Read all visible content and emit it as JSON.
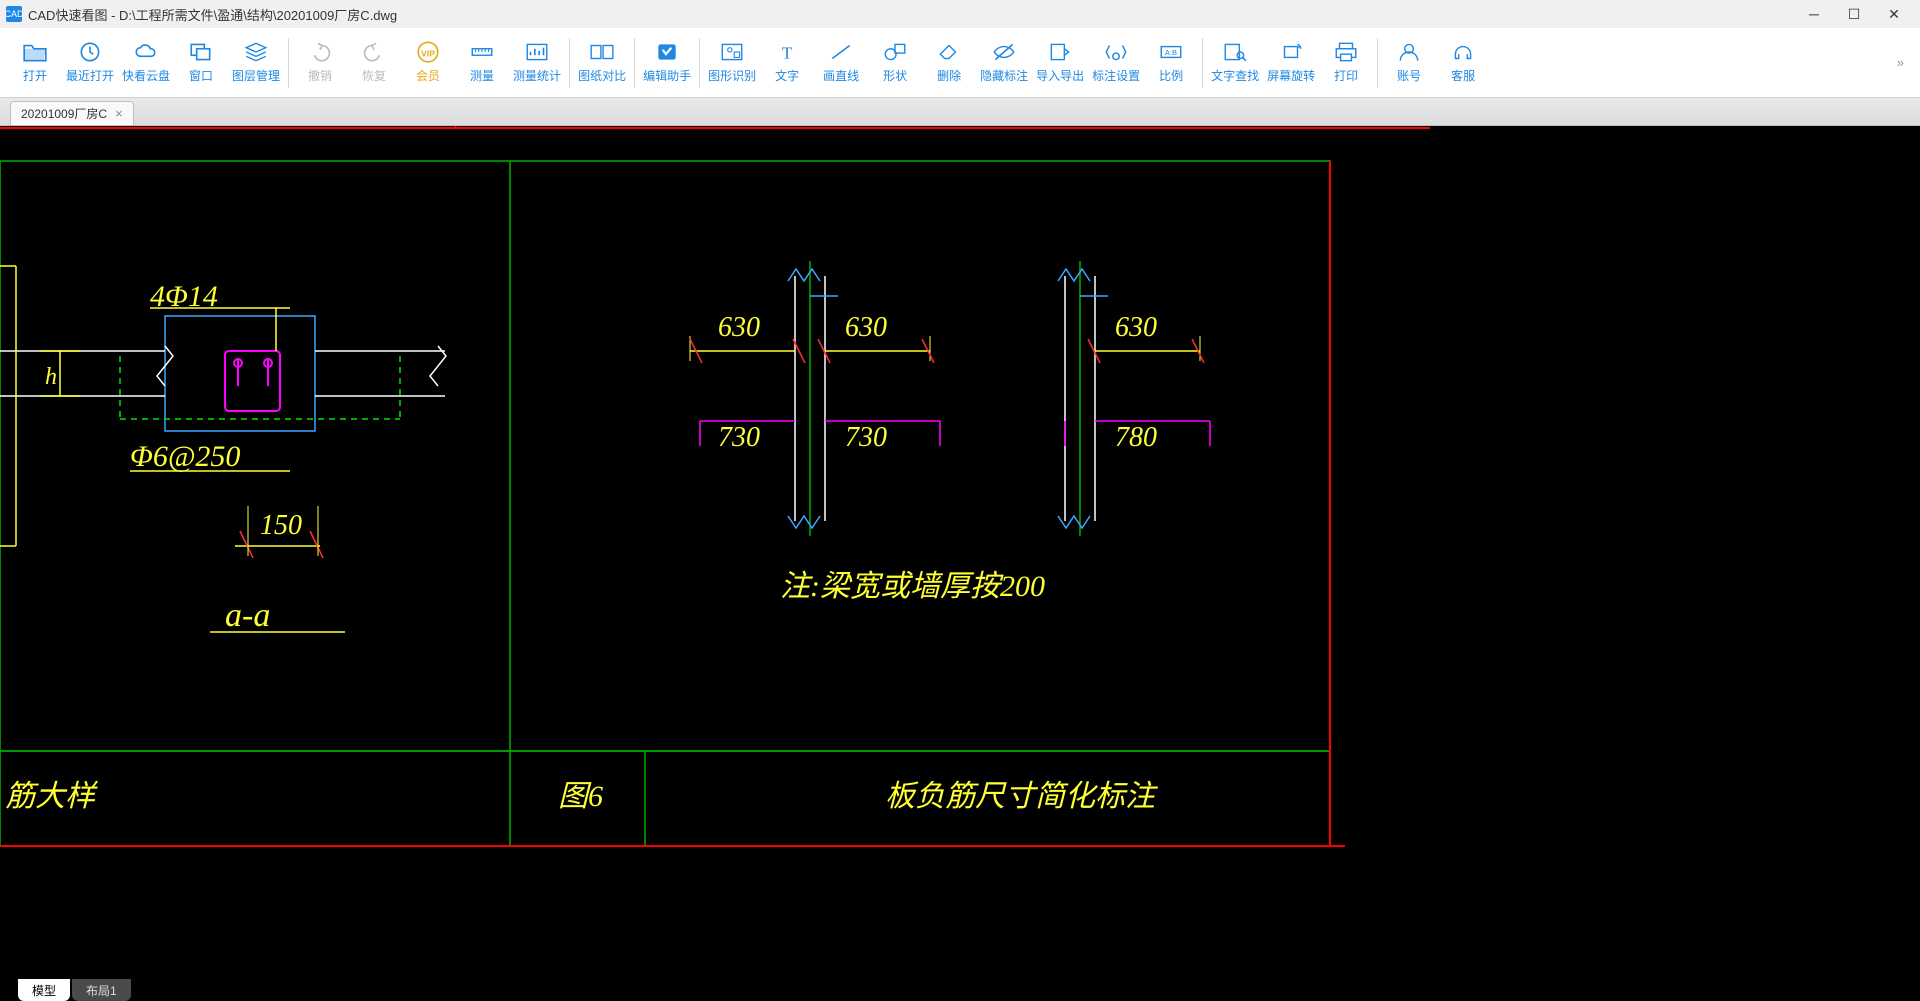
{
  "title_bar": {
    "app_name": "CAD快速看图",
    "file_path": "D:\\工程所需文件\\盈通\\结构\\20201009厂房C.dwg"
  },
  "toolbar": {
    "open": "打开",
    "recent": "最近打开",
    "quick_cloud": "快看云盘",
    "window": "窗口",
    "layers": "图层管理",
    "undo": "撤销",
    "redo": "恢复",
    "vip": "会员",
    "measure": "测量",
    "measure_stats": "测量统计",
    "compare": "图纸对比",
    "edit_helper": "编辑助手",
    "shape_rec": "图形识别",
    "text": "文字",
    "line": "画直线",
    "shape": "形状",
    "delete": "删除",
    "hide_ann": "隐藏标注",
    "import_export": "导入导出",
    "ann_settings": "标注设置",
    "scale": "比例",
    "find_text": "文字查找",
    "rotate": "屏幕旋转",
    "print": "打印",
    "account": "账号",
    "support": "客服"
  },
  "doc_tab": {
    "label": "20201009厂房C",
    "close": "×"
  },
  "drawing": {
    "rebar_spec": "4Φ14",
    "stirrup_spec": "Φ6@250",
    "h_label": "h",
    "dim_150": "150",
    "section_label": "a-a",
    "dim_630_l": "630",
    "dim_630_r": "630",
    "dim_630_r2": "630",
    "dim_730_l": "730",
    "dim_730_r": "730",
    "dim_780": "780",
    "note": "注:梁宽或墙厚按200",
    "title_left": "筋大样",
    "fig_num": "图6",
    "title_right": "板负筋尺寸简化标注"
  },
  "bottom_tabs": {
    "model": "模型",
    "layout1": "布局1"
  }
}
